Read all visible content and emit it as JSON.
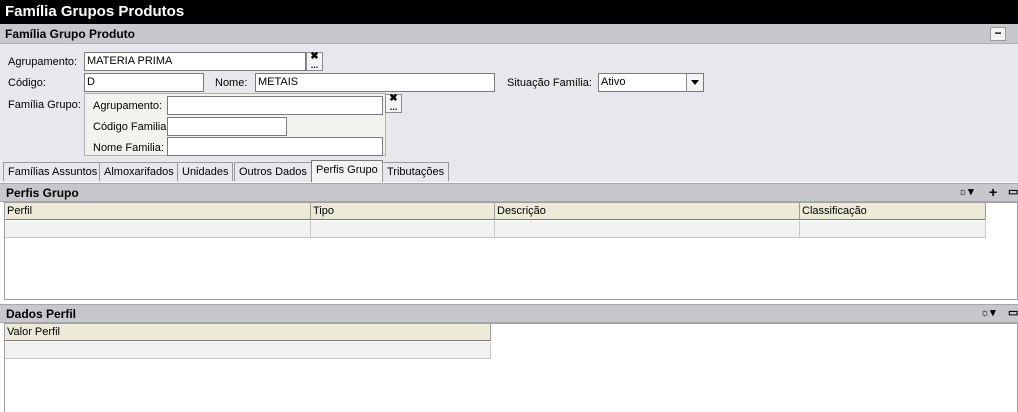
{
  "window": {
    "title": "Família Grupos Produtos"
  },
  "form": {
    "section_title": "Família Grupo Produto",
    "collapse_label": "−",
    "agrupamento": {
      "label": "Agrupamento:",
      "value": "MATERIA PRIMA"
    },
    "codigo": {
      "label": "Código:",
      "value": "D"
    },
    "nome": {
      "label": "Nome:",
      "value": "METAIS"
    },
    "situacao": {
      "label": "Situação Família:",
      "value": "Ativo"
    },
    "familia_grupo": {
      "label": "Família Grupo:",
      "agrupamento": {
        "label": "Agrupamento:",
        "value": ""
      },
      "codigo_familia": {
        "label": "Código Familia:",
        "value": ""
      },
      "nome_familia": {
        "label": "Nome Familia:",
        "value": ""
      }
    },
    "clear_glyph": "✖",
    "lookup_glyph": "..."
  },
  "tabs": [
    {
      "label": "Famílias Assuntos",
      "active": false
    },
    {
      "label": "Almoxarifados",
      "active": false
    },
    {
      "label": "Unidades",
      "active": false
    },
    {
      "label": "Outros Dados",
      "active": false
    },
    {
      "label": "Perfis Grupo",
      "active": true
    },
    {
      "label": "Tributações",
      "active": false
    }
  ],
  "perfis_grupo": {
    "title": "Perfis Grupo",
    "columns": [
      "Perfil",
      "Tipo",
      "Descrição",
      "Classificação"
    ],
    "rows": [
      [
        "",
        "",
        "",
        ""
      ]
    ],
    "toolbar_icons": [
      "view-options-icon",
      "add-icon",
      "export-icon"
    ]
  },
  "dados_perfil": {
    "title": "Dados Perfil",
    "columns": [
      "Valor Perfil"
    ],
    "rows": [
      [
        ""
      ]
    ],
    "toolbar_icons": [
      "view-options-icon",
      "export-icon"
    ]
  },
  "colors": {
    "titlebar": "#000000",
    "section_header": "#c8c8cc",
    "grid_header": "#ecebd8",
    "form_bg": "#e8e8ec"
  }
}
